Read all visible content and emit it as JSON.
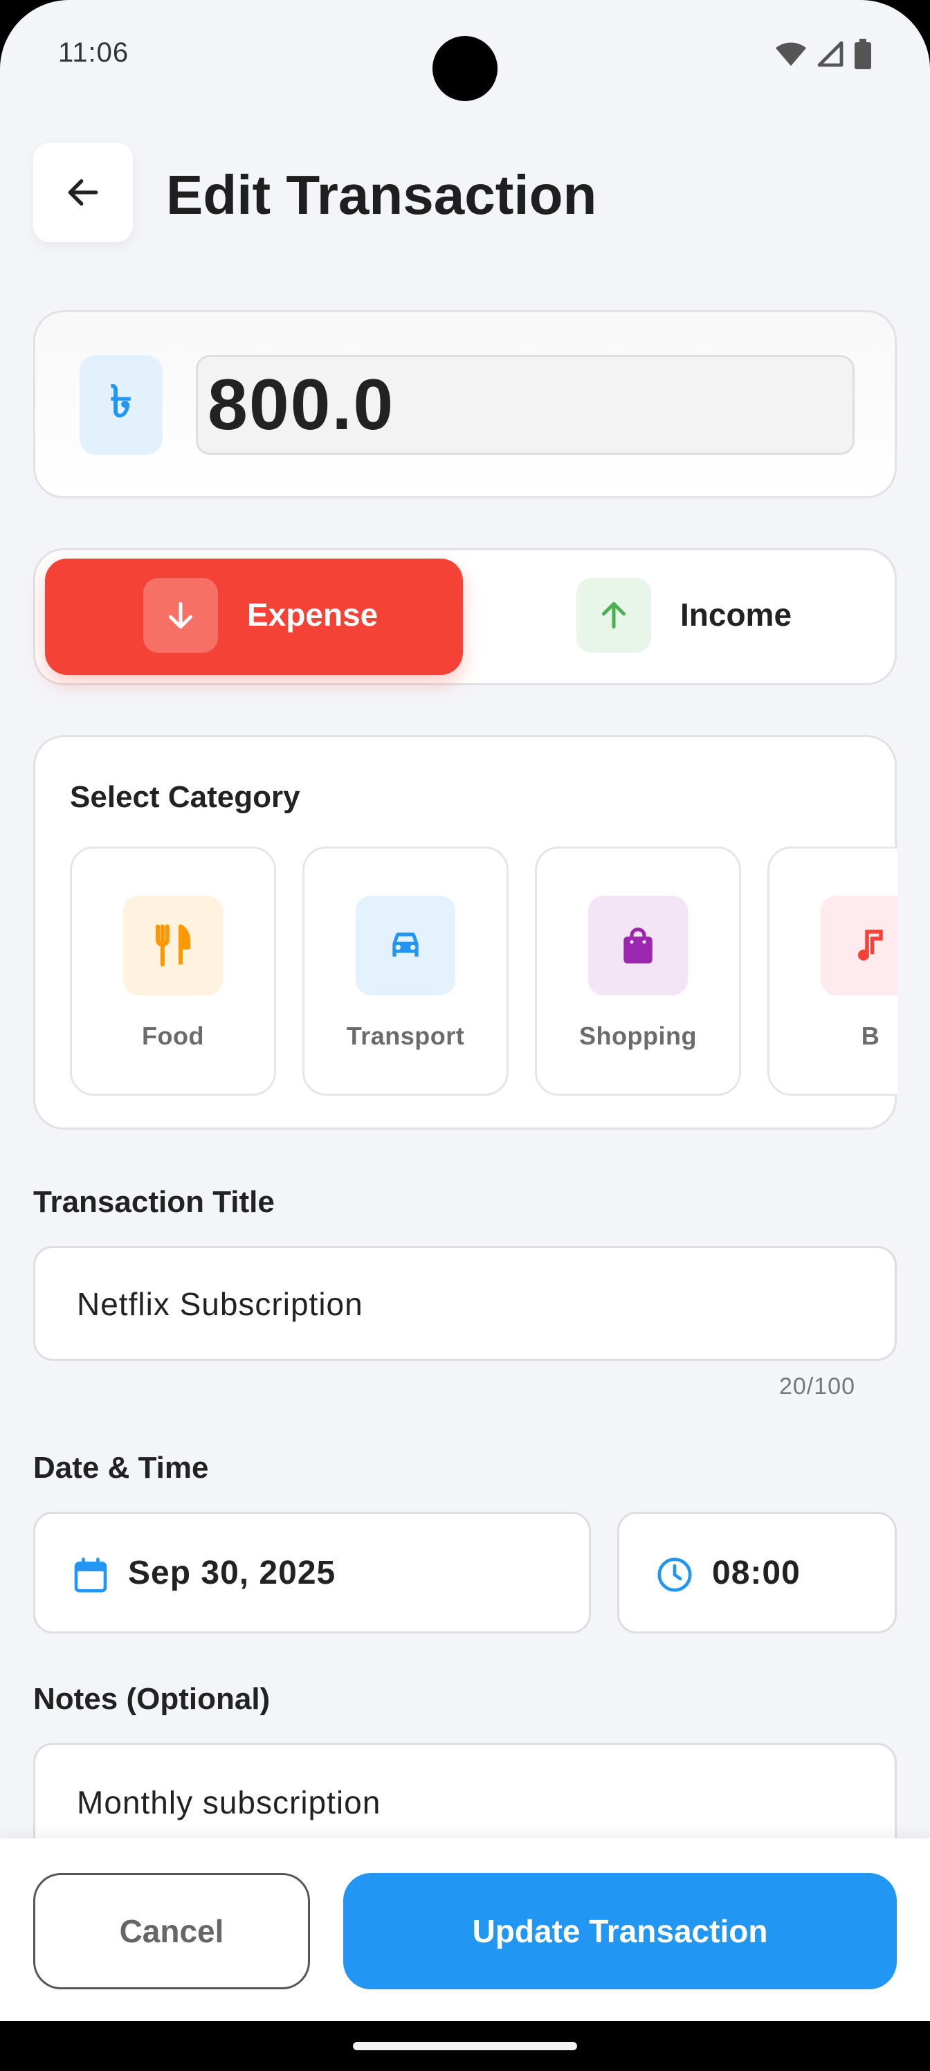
{
  "status_bar": {
    "time": "11:06"
  },
  "header": {
    "title": "Edit Transaction"
  },
  "amount": {
    "currency_symbol": "৳",
    "value": "800.0"
  },
  "type_toggle": {
    "expense_label": "Expense",
    "income_label": "Income",
    "selected": "Expense"
  },
  "category": {
    "heading": "Select Category",
    "items": [
      {
        "label": "Food",
        "icon": "utensils-icon",
        "color": "#ff9800",
        "bg": "#fff3e0"
      },
      {
        "label": "Transport",
        "icon": "car-icon",
        "color": "#2196f3",
        "bg": "#e3f2fd"
      },
      {
        "label": "Shopping",
        "icon": "shopping-bag-icon",
        "color": "#9c27b0",
        "bg": "#f3e5f5"
      },
      {
        "label": "B",
        "icon": "music-note-icon",
        "color": "#f44336",
        "bg": "#ffebee"
      }
    ]
  },
  "transaction_title": {
    "label": "Transaction Title",
    "value": "Netflix Subscription",
    "counter": "20/100"
  },
  "date_time": {
    "label": "Date & Time",
    "date": "Sep 30, 2025",
    "time": "08:00"
  },
  "notes": {
    "label": "Notes (Optional)",
    "value": "Monthly subscription"
  },
  "actions": {
    "cancel_label": "Cancel",
    "update_label": "Update Transaction"
  },
  "colors": {
    "accent": "#2196f3",
    "expense": "#f44336",
    "income": "#4caf50",
    "background": "#f4f5f9"
  }
}
